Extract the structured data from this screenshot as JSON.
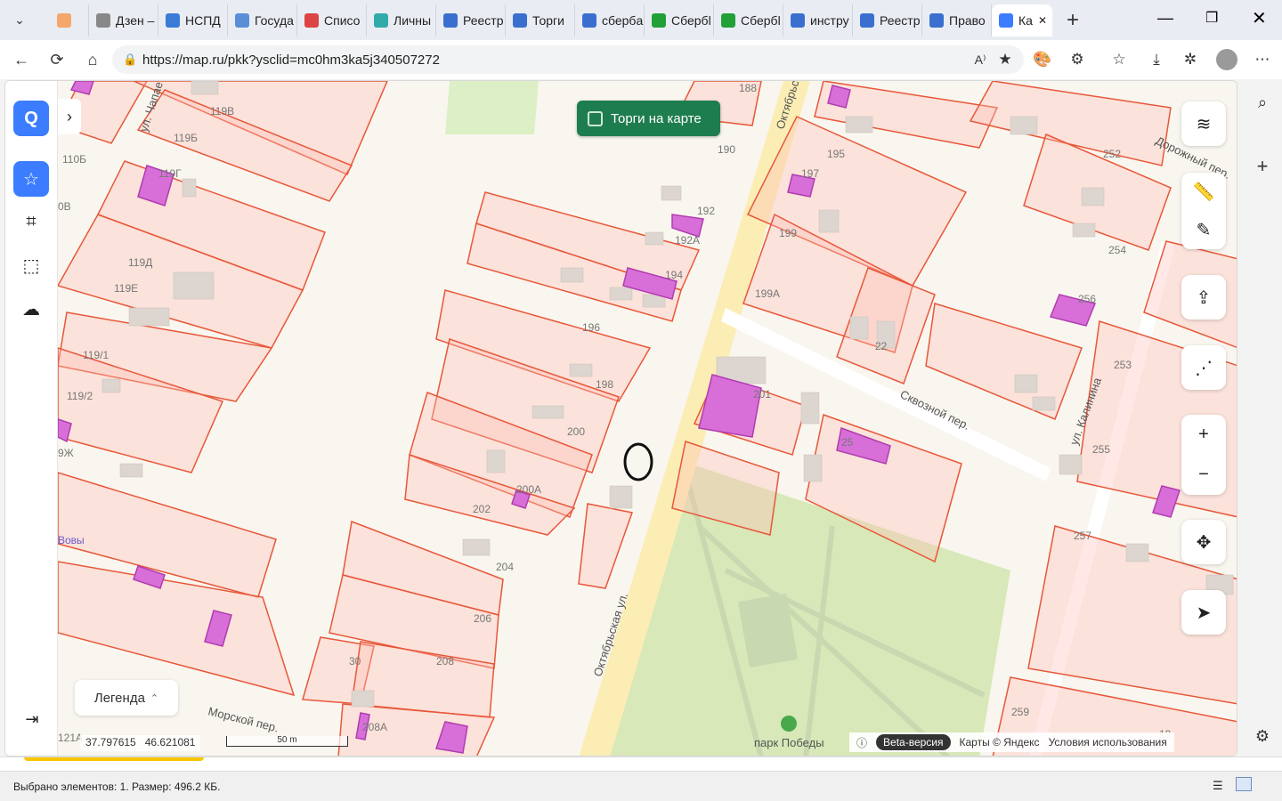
{
  "tabs": [
    {
      "label": "",
      "color": "#f5a66a"
    },
    {
      "label": "Дзен –",
      "color": "#888888"
    },
    {
      "label": "НСПД",
      "color": "#3a7bd5"
    },
    {
      "label": "Госуда",
      "color": "#5a8fd8"
    },
    {
      "label": "Списо",
      "color": "#d44"
    },
    {
      "label": "Личны",
      "color": "#3aa"
    },
    {
      "label": "Реестр",
      "color": "#3a6fd0"
    },
    {
      "label": "Торги",
      "color": "#3a6fd0"
    },
    {
      "label": "сбербa",
      "color": "#3a6fd0"
    },
    {
      "label": "Сбербl",
      "color": "#21a038"
    },
    {
      "label": "Сбербl",
      "color": "#21a038"
    },
    {
      "label": "инстру",
      "color": "#3a6fd0"
    },
    {
      "label": "Реестр",
      "color": "#3a6fd0"
    },
    {
      "label": "Право",
      "color": "#3a6fd0"
    },
    {
      "label": "Ка",
      "color": "#3c7dff"
    }
  ],
  "address": {
    "url": "https://map.ru/pkk?ysclid=mc0hm3ka5j340507272"
  },
  "map": {
    "torgi_label": "Торги на карте",
    "legend_label": "Легенда",
    "coord_lon": "37.797615",
    "coord_lat": "46.621081",
    "scale_label": "50 m",
    "beta_label": "Beta-версия",
    "attribution": "Карты © Яндекс",
    "terms": "Условия использования",
    "park_label": "парк Победы"
  },
  "streets": {
    "oktyabrskaya": "Октябрьская ул.",
    "oktyabrskaya_top": "Октябрьская",
    "skvoznoy": "Сквозной пер.",
    "kalinina": "ул. Калинина",
    "morskoy": "Морской пер.",
    "dorozhny": "Дорожный пер.",
    "chapaeva": "ул. Чапае"
  },
  "parcel_labels": {
    "l119v": "119В",
    "l119b": "119Б",
    "l110b": "110Б",
    "l119g": "119Г",
    "l0v": "0В",
    "l119d": "119Д",
    "l119e": "119Е",
    "l119_1": "119/1",
    "l119_2": "119/2",
    "l9zh": "9Ж",
    "l188": "188",
    "l190": "190",
    "l192": "192",
    "l192a": "192А",
    "l194": "194",
    "l195": "195",
    "l197": "197",
    "l199": "199",
    "l199a": "199А",
    "l196": "196",
    "l198": "198",
    "l200": "200",
    "l200a": "200А",
    "l202": "202",
    "l204": "204",
    "l206": "206",
    "l208": "208",
    "l208a": "208А",
    "l30": "30",
    "l201": "201",
    "l22": "22",
    "l25": "25",
    "l252": "252",
    "l254": "254",
    "l256": "256",
    "l253": "253",
    "l255": "255",
    "l257": "257",
    "l259": "259",
    "l19": "19",
    "l121a": "121А",
    "vovy": "Вовы"
  },
  "status": {
    "text": "Выбрано элементов: 1. Размер: 496.2 КБ."
  }
}
